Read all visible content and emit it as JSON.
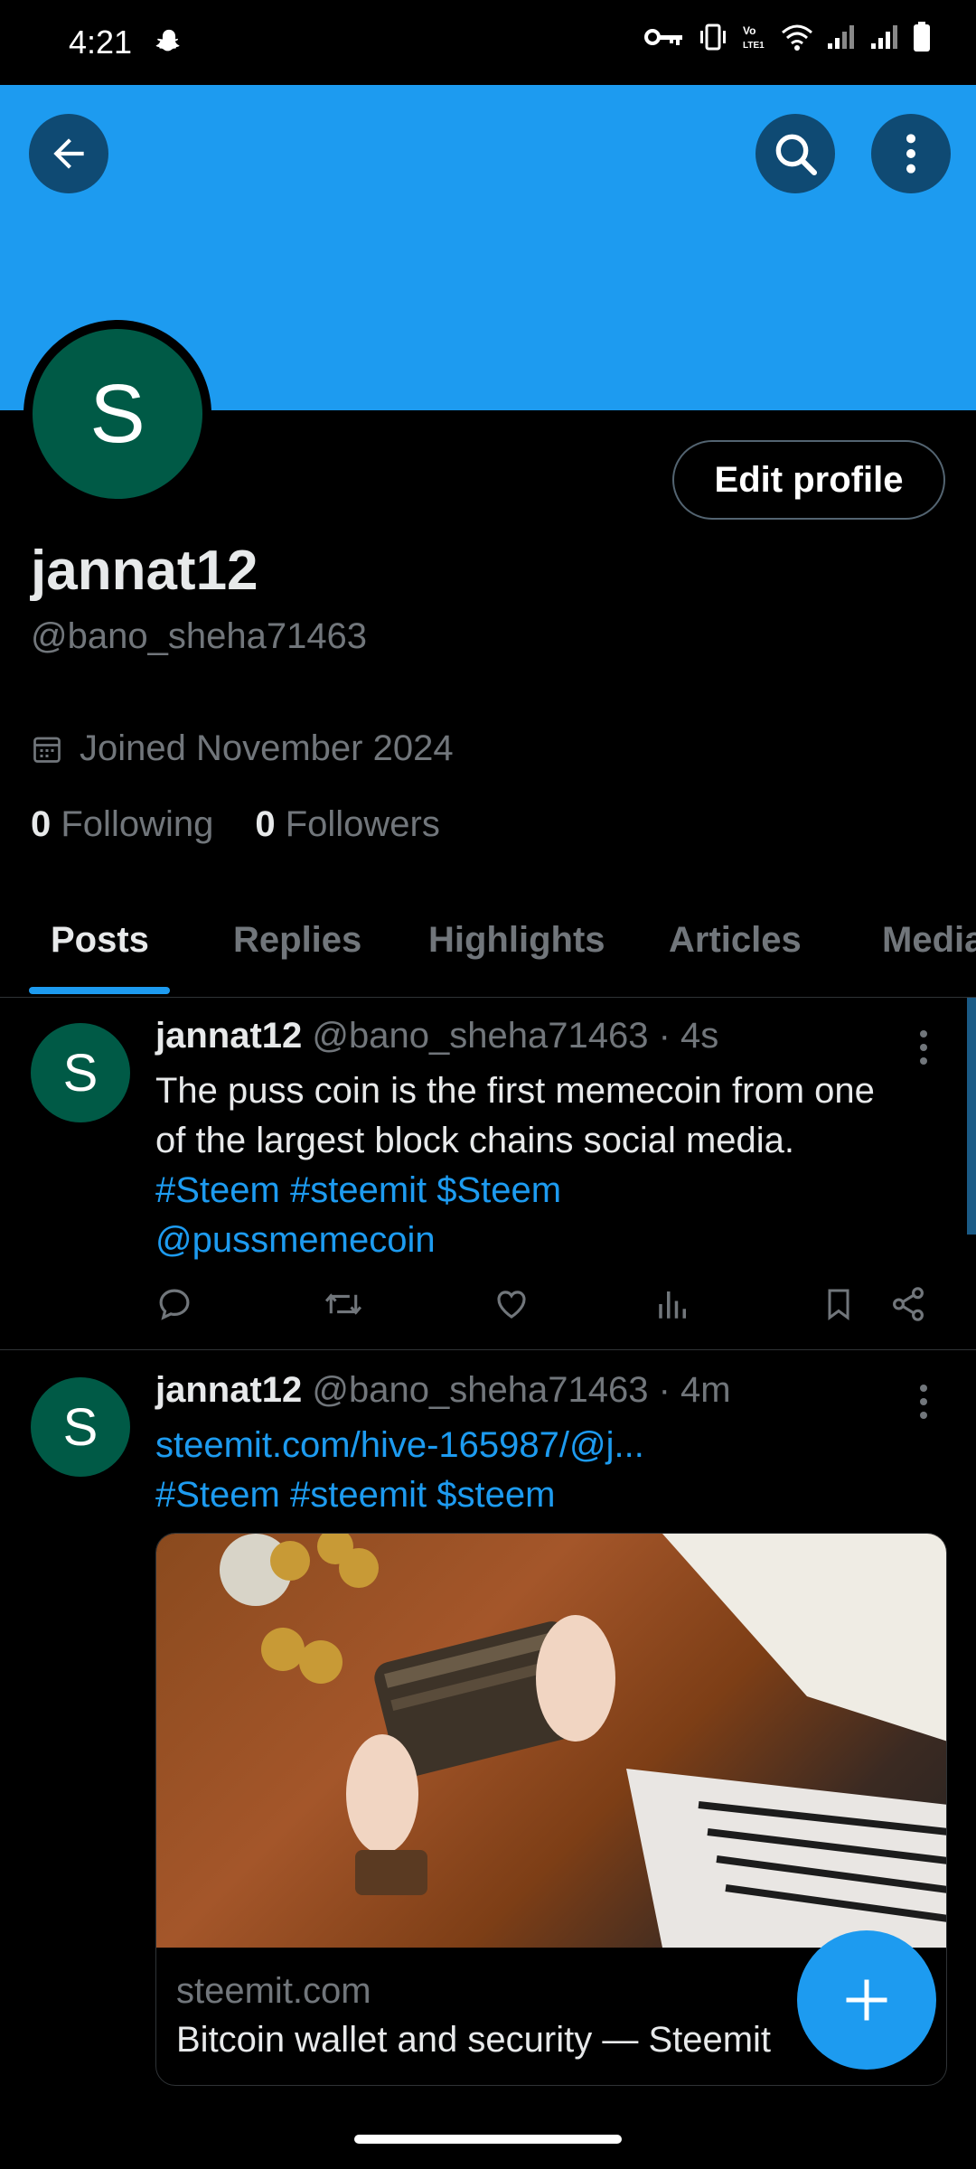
{
  "status_bar": {
    "time": "4:21"
  },
  "profile": {
    "avatar_letter": "S",
    "edit_label": "Edit profile",
    "display_name": "jannat12",
    "handle": "@bano_sheha71463",
    "joined": "Joined November 2024",
    "following_count": "0",
    "following_label": "Following",
    "followers_count": "0",
    "followers_label": "Followers"
  },
  "tabs": [
    {
      "label": "Posts",
      "active": true
    },
    {
      "label": "Replies"
    },
    {
      "label": "Highlights"
    },
    {
      "label": "Articles"
    },
    {
      "label": "Media"
    }
  ],
  "tweets": [
    {
      "avatar_letter": "S",
      "name": "jannat12",
      "meta": "@bano_sheha71463 · 4s",
      "text_line1": "The puss coin is the first memecoin from one",
      "text_line2": "of the largest block chains social media.",
      "hashtags": "#Steem #steemit $Steem",
      "mention": "@pussmemecoin"
    },
    {
      "avatar_letter": "S",
      "name": "jannat12",
      "meta": "@bano_sheha71463 · 4m",
      "link": "steemit.com/hive-165987/@j...",
      "hashtags": "#Steem #steemit $steem",
      "card_domain": "steemit.com",
      "card_title": "Bitcoin wallet and security — Steemit"
    }
  ],
  "colors": {
    "accent": "#1d9bf0",
    "avatar": "#005a46",
    "muted": "#71767b"
  }
}
